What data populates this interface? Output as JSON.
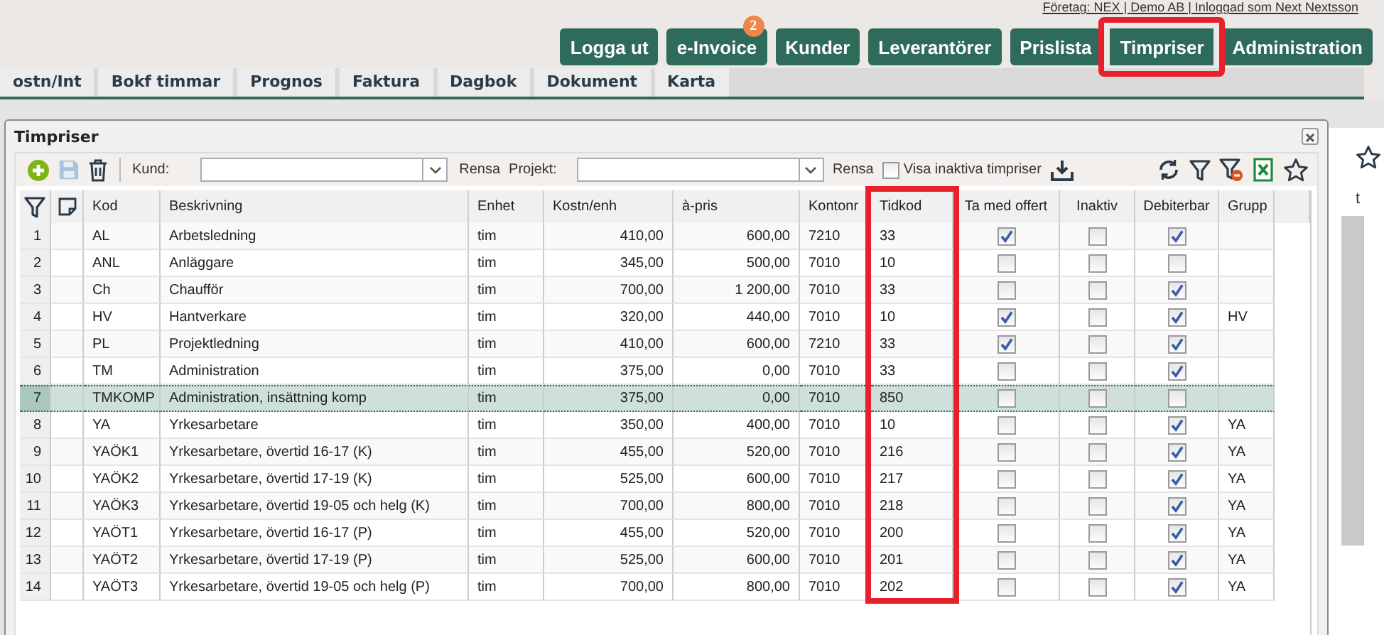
{
  "header": {
    "company_info": "Företag: NEX | Demo AB | Inloggad som Next Nextsson",
    "buttons": [
      {
        "label": "Logga ut",
        "highlighted": false
      },
      {
        "label": "e-Invoice",
        "badge": "2",
        "highlighted": false
      },
      {
        "label": "Kunder",
        "highlighted": false
      },
      {
        "label": "Leverantörer",
        "highlighted": false
      },
      {
        "label": "Prislista",
        "highlighted": false
      },
      {
        "label": "Timpriser",
        "highlighted": true
      },
      {
        "label": "Administration",
        "highlighted": false
      }
    ]
  },
  "tabs": [
    {
      "label": "ostn/Int"
    },
    {
      "label": "Bokf timmar"
    },
    {
      "label": "Prognos"
    },
    {
      "label": "Faktura"
    },
    {
      "label": "Dagbok"
    },
    {
      "label": "Dokument"
    },
    {
      "label": "Karta"
    }
  ],
  "background_panel": {
    "column_label": "t"
  },
  "dialog": {
    "title": "Timpriser",
    "toolbar": {
      "customer_label": "Kund:",
      "customer_clear": "Rensa",
      "project_label": "Projekt:",
      "project_clear": "Rensa",
      "show_inactive": {
        "label": "Visa inaktiva timpriser",
        "checked": false
      }
    },
    "table": {
      "columns": [
        {
          "label": "Kod",
          "kind": "text",
          "highlighted": false
        },
        {
          "label": "Beskrivning",
          "kind": "text",
          "highlighted": false
        },
        {
          "label": "Enhet",
          "kind": "text",
          "highlighted": false
        },
        {
          "label": "Kostn/enh",
          "kind": "number",
          "highlighted": false
        },
        {
          "label": "à-pris",
          "kind": "number",
          "highlighted": false
        },
        {
          "label": "Kontonr",
          "kind": "text",
          "highlighted": false
        },
        {
          "label": "Tidkod",
          "kind": "text",
          "highlighted": true
        },
        {
          "label": "Ta med offert",
          "kind": "check",
          "highlighted": false
        },
        {
          "label": "Inaktiv",
          "kind": "check",
          "highlighted": false
        },
        {
          "label": "Debiterbar",
          "kind": "check",
          "highlighted": false
        },
        {
          "label": "Grupp",
          "kind": "text",
          "highlighted": false
        }
      ],
      "rows": [
        {
          "number": "1",
          "selected": false,
          "cells": [
            "AL",
            "Arbetsledning",
            "tim",
            "410,00",
            "600,00",
            "7210",
            "33",
            true,
            false,
            true,
            null
          ]
        },
        {
          "number": "2",
          "selected": false,
          "cells": [
            "ANL",
            "Anläggare",
            "tim",
            "345,00",
            "500,00",
            "7010",
            "10",
            false,
            false,
            false,
            null
          ]
        },
        {
          "number": "3",
          "selected": false,
          "cells": [
            "Ch",
            "Chaufför",
            "tim",
            "700,00",
            "1 200,00",
            "7010",
            "33",
            false,
            false,
            true,
            null
          ]
        },
        {
          "number": "4",
          "selected": false,
          "cells": [
            "HV",
            "Hantverkare",
            "tim",
            "320,00",
            "440,00",
            "7010",
            "10",
            true,
            false,
            true,
            "HV"
          ]
        },
        {
          "number": "5",
          "selected": false,
          "cells": [
            "PL",
            "Projektledning",
            "tim",
            "410,00",
            "600,00",
            "7210",
            "33",
            true,
            false,
            true,
            null
          ]
        },
        {
          "number": "6",
          "selected": false,
          "cells": [
            "TM",
            "Administration",
            "tim",
            "375,00",
            "0,00",
            "7010",
            "33",
            false,
            false,
            true,
            null
          ]
        },
        {
          "number": "7",
          "selected": true,
          "cells": [
            "TMKOMP",
            "Administration, insättning komp",
            "tim",
            "375,00",
            "0,00",
            "7010",
            "850",
            false,
            false,
            false,
            null
          ]
        },
        {
          "number": "8",
          "selected": false,
          "cells": [
            "YA",
            "Yrkesarbetare",
            "tim",
            "350,00",
            "400,00",
            "7010",
            "10",
            false,
            false,
            true,
            "YA"
          ]
        },
        {
          "number": "9",
          "selected": false,
          "cells": [
            "YAÖK1",
            "Yrkesarbetare, övertid 16-17 (K)",
            "tim",
            "455,00",
            "520,00",
            "7010",
            "216",
            false,
            false,
            true,
            "YA"
          ]
        },
        {
          "number": "10",
          "selected": false,
          "cells": [
            "YAÖK2",
            "Yrkesarbetare, övertid 17-19 (K)",
            "tim",
            "525,00",
            "600,00",
            "7010",
            "217",
            false,
            false,
            true,
            "YA"
          ]
        },
        {
          "number": "11",
          "selected": false,
          "cells": [
            "YAÖK3",
            "Yrkesarbetare, övertid 19-05 och helg (K)",
            "tim",
            "700,00",
            "800,00",
            "7010",
            "218",
            false,
            false,
            true,
            "YA"
          ]
        },
        {
          "number": "12",
          "selected": false,
          "cells": [
            "YAÖT1",
            "Yrkesarbetare, övertid 16-17 (P)",
            "tim",
            "455,00",
            "520,00",
            "7010",
            "200",
            false,
            false,
            true,
            "YA"
          ]
        },
        {
          "number": "13",
          "selected": false,
          "cells": [
            "YAÖT2",
            "Yrkesarbetare, övertid 17-19 (P)",
            "tim",
            "525,00",
            "600,00",
            "7010",
            "201",
            false,
            false,
            true,
            "YA"
          ]
        },
        {
          "number": "14",
          "selected": false,
          "cells": [
            "YAÖT3",
            "Yrkesarbetare, övertid 19-05 och helg (P)",
            "tim",
            "700,00",
            "800,00",
            "7010",
            "202",
            false,
            false,
            true,
            "YA"
          ]
        }
      ]
    }
  }
}
